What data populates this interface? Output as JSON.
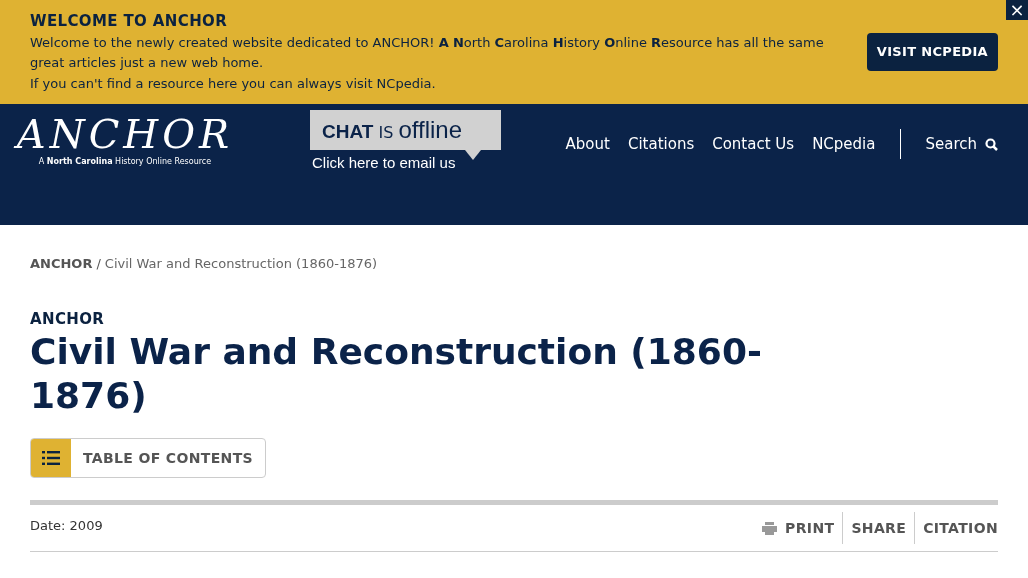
{
  "banner": {
    "title": "WELCOME TO ANCHOR",
    "message": "Welcome to the newly created website dedicated to ANCHOR! **A** **N**orth **C**arolina **H**istory **O**nline **R**esource has all the same great articles just a new web home.",
    "note": "If you can't find a resource here you can always visit NCpedia.",
    "button": "VISIT NCPEDIA",
    "close": "×"
  },
  "header": {
    "logo": "ANCHOR",
    "tagline": "A **North Carolina** History Online Resource",
    "chat": {
      "status_lead": "CHAT",
      "status_mid": "IS",
      "status_tail": "offline",
      "link": "Click here to email us"
    },
    "nav": [
      "About",
      "Citations",
      "Contact Us",
      "NCpedia"
    ],
    "search": "Search"
  },
  "breadcrumb": [
    {
      "label": "ANCHOR",
      "kind": "link"
    },
    {
      "label": "/",
      "kind": "separator"
    },
    {
      "label": "Civil War and Reconstruction (1860-1876)",
      "kind": "current"
    }
  ],
  "page": {
    "eyebrow": "ANCHOR",
    "title": "Civil War and Reconstruction (1860-1876)",
    "toc": "TABLE OF CONTENTS",
    "date": "Date: 2009",
    "actions": [
      {
        "label": "PRINT",
        "kind": "print"
      },
      {
        "label": "SHARE",
        "kind": "plain"
      },
      {
        "label": "CITATION",
        "kind": "plain"
      }
    ]
  }
}
